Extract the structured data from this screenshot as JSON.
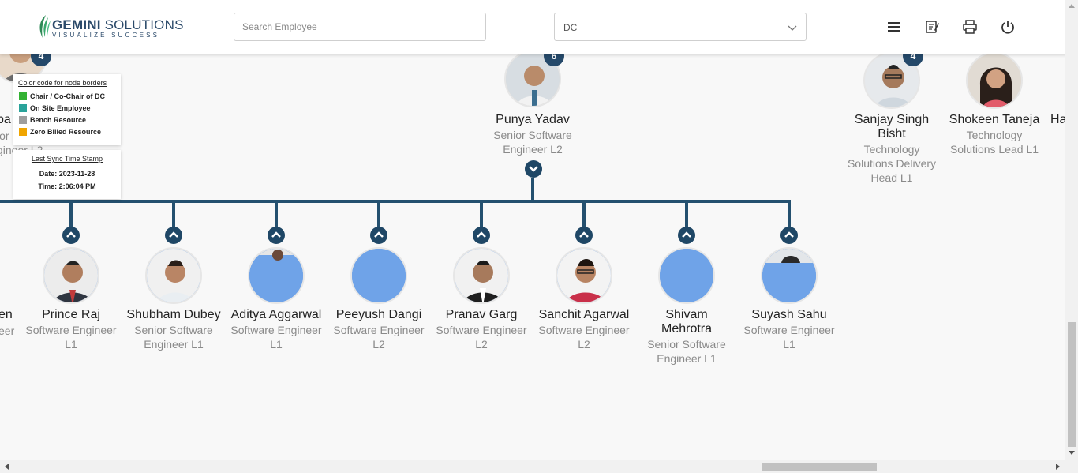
{
  "header": {
    "logo_name_bold": "GEMINI",
    "logo_name_rest": " SOLUTIONS",
    "logo_tagline": "VISUALIZE SUCCESS",
    "search_placeholder": "Search Employee",
    "dc_select_value": "DC",
    "icons": [
      "menu-icon",
      "notepad-icon",
      "print-icon",
      "power-icon"
    ]
  },
  "legend": {
    "title": "Color code for node borders",
    "items": [
      {
        "label": "Chair / Co-Chair of DC",
        "color": "#33b233"
      },
      {
        "label": "On Site Employee",
        "color": "#2aa39a"
      },
      {
        "label": "Bench Resource",
        "color": "#9e9e9e"
      },
      {
        "label": "Zero Billed Resource",
        "color": "#f0a500"
      }
    ]
  },
  "sync": {
    "title": "Last Sync Time Stamp",
    "date": "Date: 2023-11-28",
    "time": "Time: 2:06:04 PM"
  },
  "colors": {
    "line": "#24506f",
    "badge": "#25496a",
    "avatar_placeholder": "#6fa3e8"
  },
  "top_nodes": [
    {
      "id": "left-partial",
      "name_fragment": "pa",
      "role_fragment_1": "ior",
      "role_fragment_2": "gineer L2",
      "badge": "4"
    },
    {
      "id": "punya-yadav",
      "name": "Punya Yadav",
      "role": "Senior Software Engineer L2",
      "badge": "6"
    },
    {
      "id": "sanjay-singh-bisht",
      "name": "Sanjay Singh Bisht",
      "role": "Technology Solutions Delivery Head L1",
      "badge": "4"
    },
    {
      "id": "shokeen-taneja",
      "name": "Shokeen Taneja",
      "role": "Technology Solutions Lead L1"
    },
    {
      "id": "right-partial",
      "name_fragment": "Ha"
    }
  ],
  "child_nodes": [
    {
      "name_fragment": "en",
      "role_fragment": "eer"
    },
    {
      "name": "Prince Raj",
      "role": "Software Engineer L1"
    },
    {
      "name": "Shubham Dubey",
      "role": "Senior Software Engineer L1"
    },
    {
      "name": "Aditya Aggarwal",
      "role": "Software Engineer L1"
    },
    {
      "name": "Peeyush Dangi",
      "role": "Software Engineer L2"
    },
    {
      "name": "Pranav Garg",
      "role": "Software Engineer L2"
    },
    {
      "name": "Sanchit Agarwal",
      "role": "Software Engineer L2"
    },
    {
      "name": "Shivam Mehrotra",
      "role": "Senior Software Engineer L1"
    },
    {
      "name": "Suyash Sahu",
      "role": "Software Engineer L1"
    }
  ]
}
